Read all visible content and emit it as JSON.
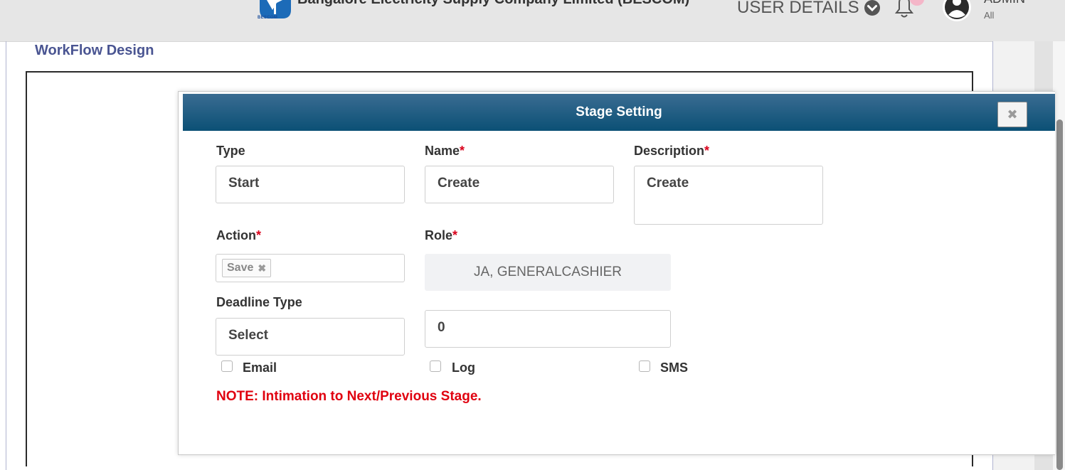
{
  "header": {
    "company_name": "Bangalore Electricity Supply Company Limited (BESCOM)",
    "logo_text": "BESCOM",
    "user_details_label": "USER DETAILS",
    "user_name": "ADMIN",
    "user_role": "All"
  },
  "page": {
    "title": "WorkFlow Design"
  },
  "modal": {
    "title": "Stage Setting",
    "close_symbol": "✖",
    "type": {
      "label": "Type",
      "value": "Start"
    },
    "name": {
      "label": "Name",
      "required_mark": "*",
      "value": "Create"
    },
    "description": {
      "label": "Description",
      "required_mark": "*",
      "value": "Create"
    },
    "action": {
      "label": "Action",
      "required_mark": "*",
      "selected_tags": [
        "Save"
      ],
      "tag_remove_symbol": "✖"
    },
    "role": {
      "label": "Role",
      "required_mark": "*",
      "value": "JA, GENERALCASHIER"
    },
    "deadline_type": {
      "label": "Deadline Type",
      "value": "Select"
    },
    "deadline_value": "0",
    "checkboxes": [
      {
        "label": "Email",
        "checked": false
      },
      {
        "label": "Log",
        "checked": false
      },
      {
        "label": "SMS",
        "checked": false
      }
    ],
    "note": "NOTE: Intimation to Next/Previous Stage."
  },
  "colors": {
    "header_gradient_top": "#3a6c92",
    "header_gradient_bottom": "#0b5075",
    "title_color": "#4a5592",
    "required_color": "#d9001b",
    "note_color": "#e0000f"
  }
}
